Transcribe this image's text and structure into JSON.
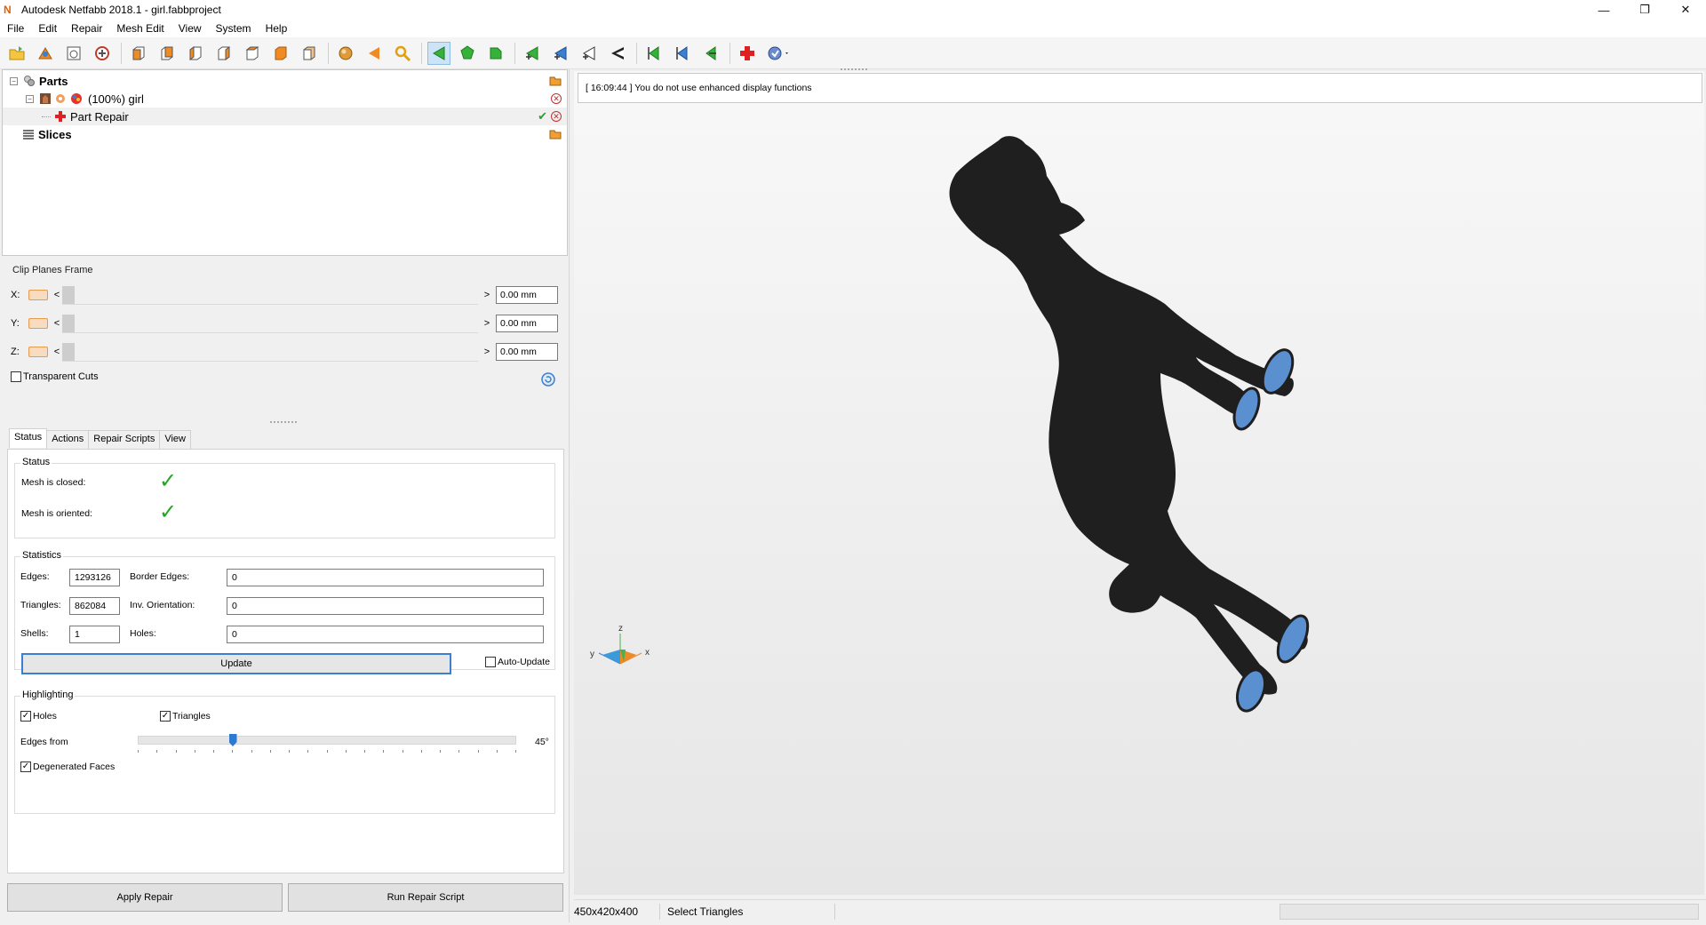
{
  "window": {
    "title": "Autodesk Netfabb 2018.1 - girl.fabbproject",
    "logo_letter": "N"
  },
  "menu": [
    "File",
    "Edit",
    "Repair",
    "Mesh Edit",
    "View",
    "System",
    "Help"
  ],
  "tree": {
    "parts_label": "Parts",
    "part_label": "(100%) girl",
    "repair_label": "Part Repair",
    "slices_label": "Slices"
  },
  "clip_planes": {
    "title": "Clip Planes Frame",
    "x_label": "X:",
    "y_label": "Y:",
    "z_label": "Z:",
    "left_arrow": "<",
    "right_arrow": ">",
    "x_value": "0.00 mm",
    "y_value": "0.00 mm",
    "z_value": "0.00 mm",
    "transparent_cuts": "Transparent Cuts"
  },
  "tabs": [
    "Status",
    "Actions",
    "Repair Scripts",
    "View"
  ],
  "status_group": {
    "title": "Status",
    "mesh_closed": "Mesh is closed:",
    "mesh_oriented": "Mesh is oriented:",
    "check": "✓"
  },
  "statistics": {
    "title": "Statistics",
    "edges_label": "Edges:",
    "edges_value": "1293126",
    "border_edges_label": "Border Edges:",
    "border_edges_value": "0",
    "triangles_label": "Triangles:",
    "triangles_value": "862084",
    "inv_orientation_label": "Inv. Orientation:",
    "inv_orientation_value": "0",
    "shells_label": "Shells:",
    "shells_value": "1",
    "holes_label": "Holes:",
    "holes_value": "0",
    "update_button": "Update",
    "auto_update": "Auto-Update"
  },
  "highlighting": {
    "title": "Highlighting",
    "holes": "Holes",
    "triangles": "Triangles",
    "edges_from": "Edges from",
    "edges_angle": "45°",
    "edges_slider_fraction": 0.25,
    "degenerated_faces": "Degenerated Faces"
  },
  "buttons": {
    "apply_repair": "Apply Repair",
    "run_repair_script": "Run Repair Script"
  },
  "log": {
    "message": "[ 16:09:44 ] You do not use enhanced display functions"
  },
  "axes": {
    "x": "x",
    "y": "y",
    "z": "z"
  },
  "statusbar": {
    "dimensions": "450x420x400",
    "mode": "Select Triangles"
  },
  "colors": {
    "mesh": "#1f1f1f",
    "paws": "#5a8fd0",
    "accent": "#3b7fd1",
    "check_green": "#24a624"
  }
}
